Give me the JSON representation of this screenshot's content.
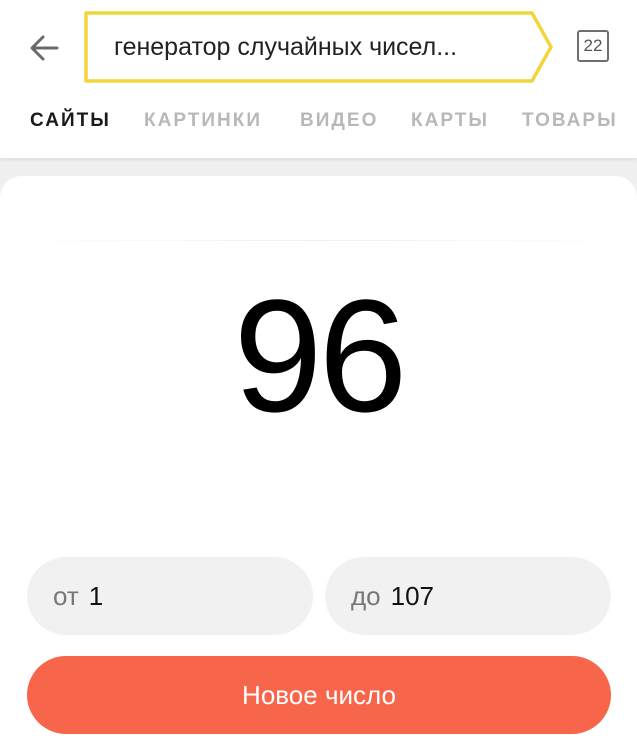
{
  "search": {
    "query": "генератор случайных чисел...",
    "tabs_count": "22"
  },
  "nav": {
    "items": [
      {
        "label": "САЙТЫ",
        "active": true
      },
      {
        "label": "КАРТИНКИ",
        "active": false
      },
      {
        "label": "ВИДЕО",
        "active": false
      },
      {
        "label": "КАРТЫ",
        "active": false
      },
      {
        "label": "ТОВАРЫ",
        "active": false
      }
    ]
  },
  "generator": {
    "result": "96",
    "from_prefix": "от",
    "from_value": "1",
    "to_prefix": "до",
    "to_value": "107",
    "button_label": "Новое число"
  },
  "colors": {
    "accent_button": "#f7654b",
    "search_border": "#f2d53c"
  },
  "icons": {
    "back": "arrow-left-icon"
  }
}
